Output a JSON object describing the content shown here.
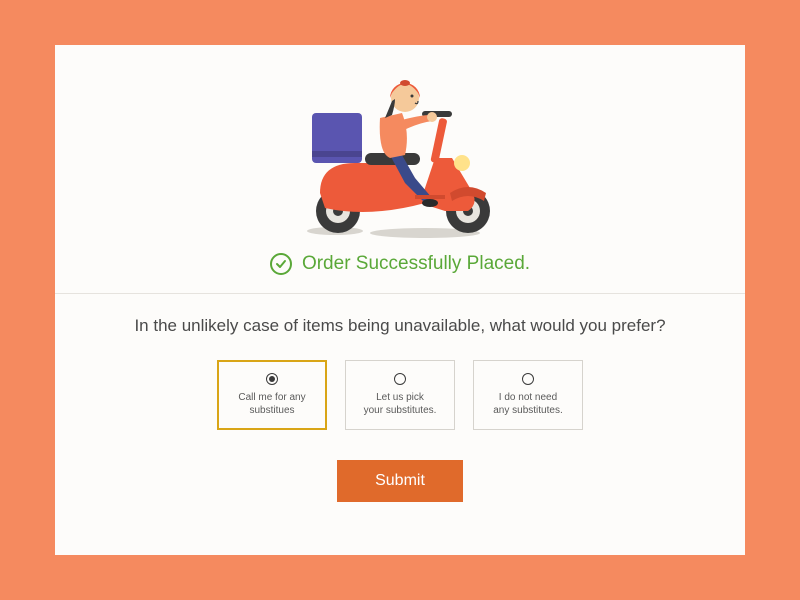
{
  "status": {
    "message": "Order Successfully Placed."
  },
  "question": "In the unlikely case of items being unavailable, what would you prefer?",
  "options": [
    {
      "label": "Call me for any\nsubstitues",
      "selected": true
    },
    {
      "label": "Let us pick\nyour substitutes.",
      "selected": false
    },
    {
      "label": "I do not need\nany substitutes.",
      "selected": false
    }
  ],
  "submit_label": "Submit"
}
